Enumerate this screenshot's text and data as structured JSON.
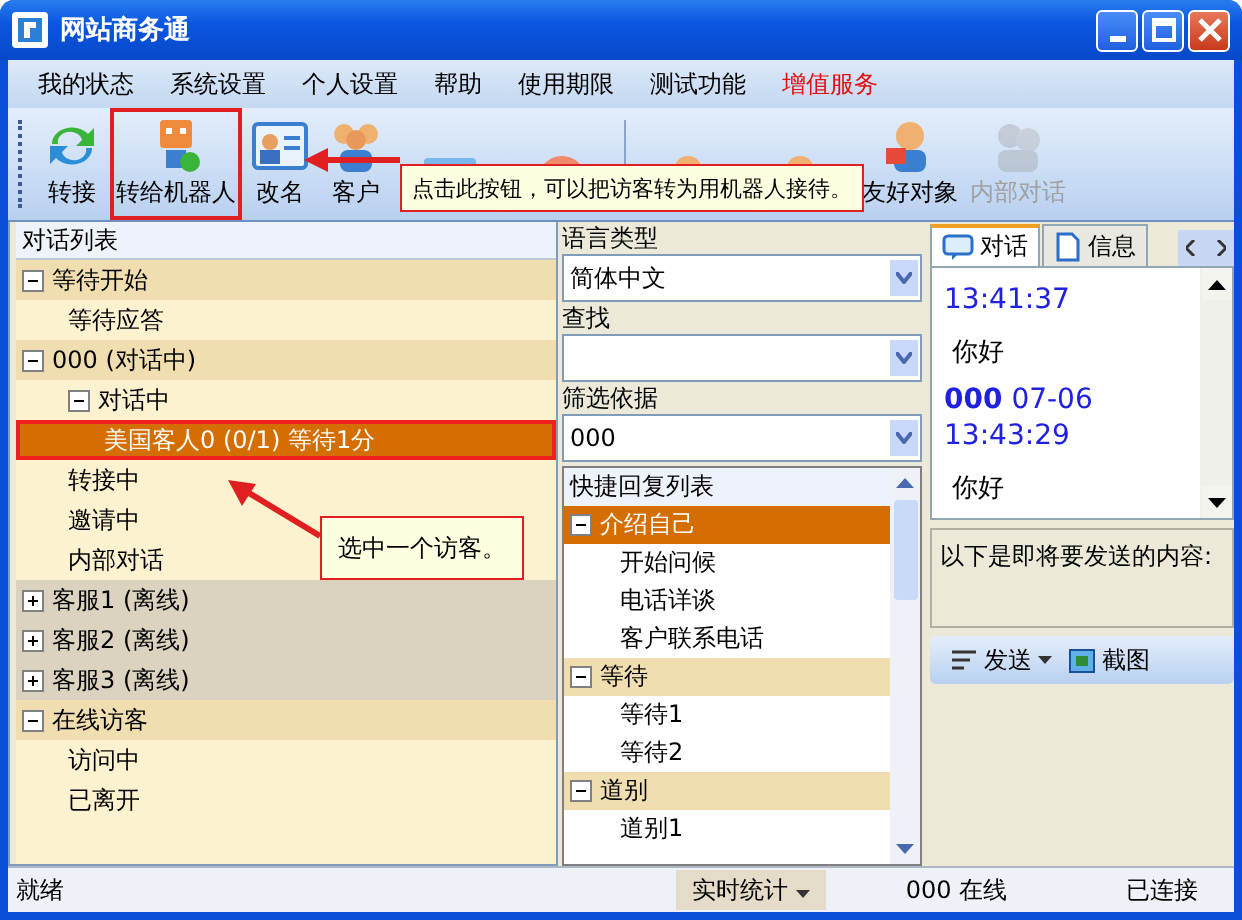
{
  "window": {
    "title": "网站商务通"
  },
  "menu": [
    {
      "label": "我的状态",
      "kind": "normal"
    },
    {
      "label": "系统设置",
      "kind": "normal"
    },
    {
      "label": "个人设置",
      "kind": "normal"
    },
    {
      "label": "帮助",
      "kind": "normal"
    },
    {
      "label": "使用期限",
      "kind": "normal"
    },
    {
      "label": "测试功能",
      "kind": "normal"
    },
    {
      "label": "增值服务",
      "kind": "promo"
    }
  ],
  "toolbar": [
    {
      "label": "转接",
      "disabled": false,
      "marked": false
    },
    {
      "label": "转给机器人",
      "disabled": false,
      "marked": true
    },
    {
      "label": "改名",
      "disabled": false,
      "marked": false
    },
    {
      "label": "客户",
      "disabled": false,
      "marked": false
    },
    {
      "disabled": false,
      "marked": false
    },
    {
      "disabled": false,
      "marked": false
    },
    {
      "disabled": false,
      "marked": false
    },
    {
      "disabled": false,
      "marked": false
    },
    {
      "label": "友好对象",
      "disabled": false,
      "marked": false
    },
    {
      "label": "内部对话",
      "disabled": true,
      "marked": false
    }
  ],
  "callouts": [
    {
      "text": "点击此按钮，可以把访客转为用机器人接待。"
    },
    {
      "text": "选中一个访客。"
    }
  ],
  "conversation_list": {
    "title": "对话列表",
    "groups": [
      {
        "label": "等待开始",
        "expanded": true,
        "children": [
          {
            "label": "等待应答",
            "selected": false
          }
        ]
      },
      {
        "label": "000 (对话中)",
        "expanded": true,
        "children": [
          {
            "label": "对话中",
            "selected": false,
            "expanded": true,
            "children": [
              {
                "label": "美国客人0 (0/1) 等待1分",
                "selected": true
              }
            ]
          },
          {
            "label": "转接中",
            "selected": false
          },
          {
            "label": "邀请中",
            "selected": false
          },
          {
            "label": "内部对话",
            "selected": false
          }
        ]
      },
      {
        "label": "客服1 (离线)",
        "expanded": false
      },
      {
        "label": "客服2 (离线)",
        "expanded": false
      },
      {
        "label": "客服3 (离线)",
        "expanded": false
      },
      {
        "label": "在线访客",
        "expanded": true,
        "children": [
          {
            "label": "访问中",
            "selected": false
          },
          {
            "label": "已离开",
            "selected": false
          }
        ]
      }
    ]
  },
  "filters": [
    {
      "label": "语言类型",
      "value": "简体中文"
    },
    {
      "label": "查找"
    },
    {
      "label": "筛选依据",
      "value": "000"
    }
  ],
  "quick_replies": {
    "title": "快捷回复列表",
    "groups": [
      {
        "label": "介绍自己",
        "selected": true,
        "children": [
          "开始问候",
          "电话详谈",
          "客户联系电话"
        ]
      },
      {
        "label": "等待",
        "selected": false,
        "children": [
          "等待1",
          "等待2"
        ]
      },
      {
        "label": "道别",
        "selected": false,
        "children": [
          "道别1"
        ]
      }
    ]
  },
  "tabs": [
    {
      "label": "对话",
      "selected": true
    },
    {
      "label": "信息",
      "selected": false
    }
  ],
  "messages": [
    {
      "time": "13:41:37",
      "text": "你好"
    },
    {
      "sender": "000",
      "date": "07-06",
      "time": "13:43:29",
      "text": "你好"
    }
  ],
  "compose": {
    "hint": "以下是即将要发送的内容:"
  },
  "send_bar": {
    "send": "发送",
    "screenshot": "截图"
  },
  "status_bar": {
    "state": "就绪",
    "stats": "实时统计",
    "online": "000 在线",
    "connection": "已连接"
  }
}
